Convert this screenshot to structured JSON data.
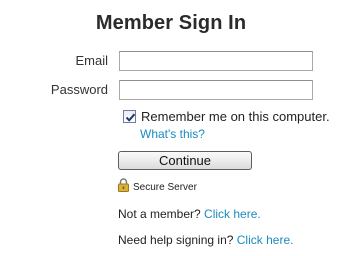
{
  "title": "Member Sign In",
  "form": {
    "email_label": "Email",
    "email_value": "",
    "password_label": "Password",
    "password_value": "",
    "remember_checked": true,
    "remember_label": "Remember me on this computer.",
    "whats_this_link": "What's this?",
    "continue_label": "Continue"
  },
  "security": {
    "icon": "lock-icon",
    "label": "Secure Server"
  },
  "links": {
    "member_prompt": "Not a member?",
    "member_link": "Click here.",
    "help_prompt": "Need help signing in?",
    "help_link": "Click here."
  },
  "colors": {
    "link": "#1a8bc0",
    "lock_body": "#d9b23a"
  }
}
